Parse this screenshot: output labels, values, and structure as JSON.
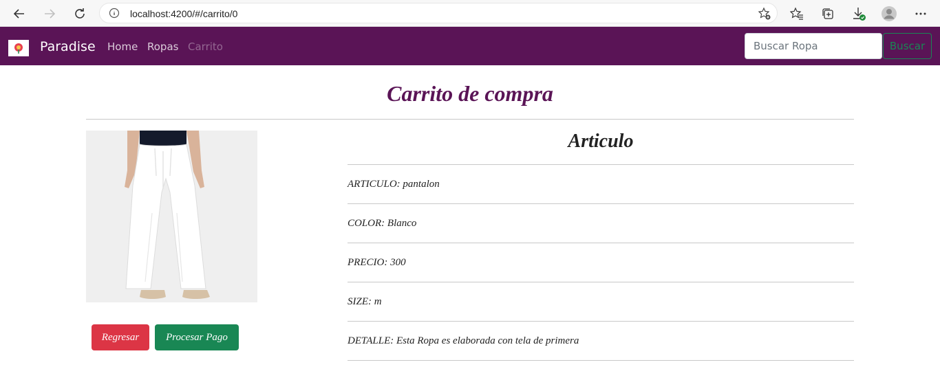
{
  "browser": {
    "url": "localhost:4200/#/carrito/0"
  },
  "navbar": {
    "brand": "Paradise",
    "links": [
      "Home",
      "Ropas",
      "Carrito"
    ],
    "search_placeholder": "Buscar Ropa",
    "search_button": "Buscar"
  },
  "page": {
    "title": "Carrito de compra",
    "section_title": "Articulo",
    "details": [
      "ARTICULO: pantalon",
      "COLOR: Blanco",
      "PRECIO: 300",
      "SIZE: m",
      "DETALLE: Esta Ropa es elaborada con tela de primera"
    ],
    "buttons": {
      "back": "Regresar",
      "pay": "Procesar Pago"
    }
  },
  "colors": {
    "navbar": "#5a1456",
    "title": "#5a1456",
    "danger": "#dc3545",
    "success": "#198754"
  }
}
